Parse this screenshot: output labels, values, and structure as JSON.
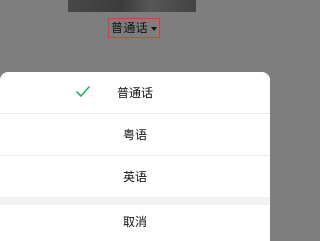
{
  "language_selector": {
    "current_label": "普通话",
    "caret_icon": "caret-down-icon",
    "highlight_color": "#e53935"
  },
  "action_sheet": {
    "options": [
      {
        "label": "普通话",
        "selected": true
      },
      {
        "label": "粤语",
        "selected": false
      },
      {
        "label": "英语",
        "selected": false
      }
    ],
    "check_icon": "checkmark-icon",
    "check_color": "#2aae67",
    "cancel_label": "取消"
  }
}
